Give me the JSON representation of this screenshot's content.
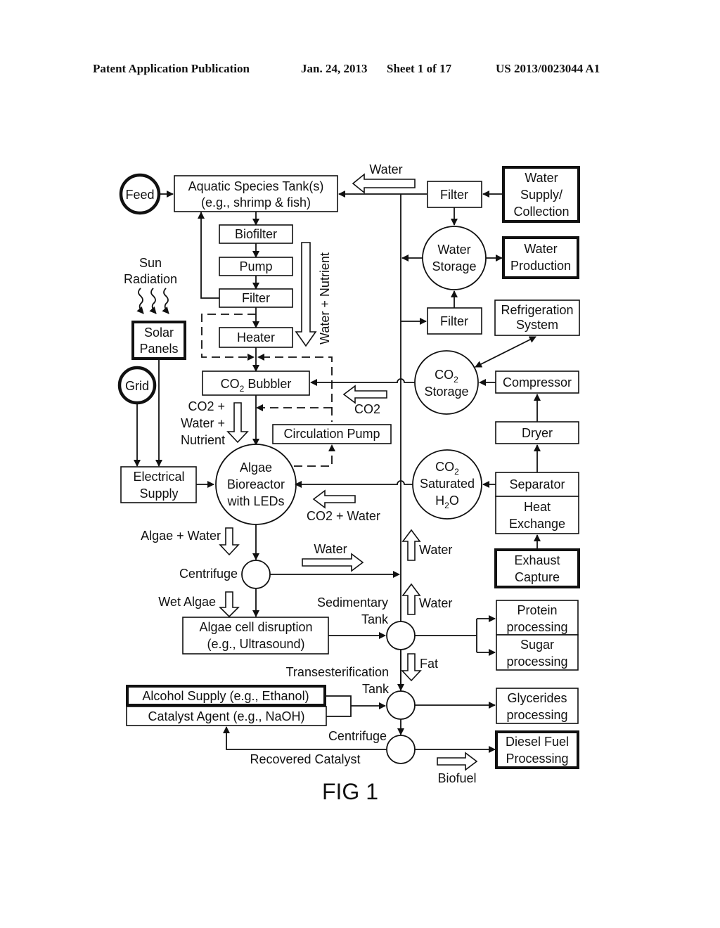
{
  "header": {
    "publication": "Patent Application Publication",
    "date": "Jan. 24, 2013",
    "sheet": "Sheet 1 of 17",
    "number": "US 2013/0023044 A1"
  },
  "figure_label": "FIG 1",
  "nodes": {
    "feed": "Feed",
    "aquatic_tank": [
      "Aquatic Species Tank(s)",
      "(e.g., shrimp & fish)"
    ],
    "biofilter": "Biofilter",
    "pump": "Pump",
    "filter_left": "Filter",
    "heater": "Heater",
    "sun_radiation": [
      "Sun",
      "Radiation"
    ],
    "solar_panels": [
      "Solar",
      "Panels"
    ],
    "grid": "Grid",
    "electrical_supply": [
      "Electrical",
      "Supply"
    ],
    "co2_bubbler": [
      "CO",
      "2",
      " Bubbler"
    ],
    "circulation_pump": "Circulation Pump",
    "algae_bioreactor": [
      "Algae",
      "Bioreactor",
      "with LEDs"
    ],
    "centrifuge_1": "Centrifuge",
    "algae_disruption": [
      "Algae cell disruption",
      "(e.g., Ultrasound)"
    ],
    "sedimentary_tank": [
      "Sedimentary",
      "Tank"
    ],
    "transesterification_tank": [
      "Transesterification",
      "Tank"
    ],
    "alcohol_supply": "Alcohol Supply (e.g., Ethanol)",
    "catalyst_agent": "Catalyst Agent (e.g., NaOH)",
    "centrifuge_2": "Centrifuge",
    "recovered_catalyst": "Recovered Catalyst",
    "filter_top": "Filter",
    "water_supply": [
      "Water",
      "Supply/",
      "Collection"
    ],
    "water_storage": [
      "Water",
      "Storage"
    ],
    "water_production": [
      "Water",
      "Production"
    ],
    "filter_mid": "Filter",
    "refrigeration": [
      "Refrigeration",
      "System"
    ],
    "co2_storage": [
      "CO",
      "2",
      "Storage"
    ],
    "compressor": "Compressor",
    "dryer": "Dryer",
    "co2_saturated": [
      "CO",
      "2",
      "Saturated",
      "H",
      "2",
      "O"
    ],
    "separator": "Separator",
    "heat_exchange": [
      "Heat",
      "Exchange"
    ],
    "exhaust_capture": [
      "Exhaust",
      "Capture"
    ],
    "protein_processing": [
      "Protein",
      "processing"
    ],
    "sugar_processing": [
      "Sugar",
      "processing"
    ],
    "glycerides_processing": [
      "Glycerides",
      "processing"
    ],
    "diesel_fuel": [
      "Diesel Fuel",
      "Processing"
    ]
  },
  "flow_labels": {
    "water_top": "Water",
    "water_nutrient": "Water + Nutrient",
    "co2_water_nutrient": [
      "CO2 +",
      "Water +",
      "Nutrient"
    ],
    "co2": "CO2",
    "co2_water": "CO2 + Water",
    "algae_water": "Algae + Water",
    "water_centrifuge": "Water",
    "wet_algae": "Wet Algae",
    "water_up_1": "Water",
    "water_up_2": "Water",
    "fat": "Fat",
    "biofuel": "Biofuel"
  }
}
